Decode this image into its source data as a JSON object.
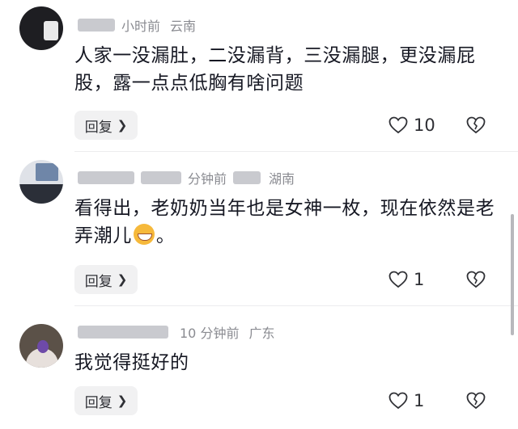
{
  "comments": [
    {
      "location": "云南",
      "time_partial": "小时前",
      "text": "人家一没漏肚，二没漏背，三没漏腿，更没漏屁股，露一点点低胸有啥问题",
      "reply_label": "回复",
      "likes": "10"
    },
    {
      "location": "湖南",
      "time_partial": "分钟前",
      "text_before_emoji": "看得出，老奶奶当年也是女神一枚，现在依然是老弄潮儿",
      "text_after_emoji": "。",
      "emoji": "grinning-emoji",
      "reply_label": "回复",
      "likes": "1"
    },
    {
      "location": "广东",
      "time_partial": "10 分钟前",
      "text": "我觉得挺好的",
      "reply_label": "回复",
      "likes": "1"
    }
  ],
  "icons": {
    "like": "heart-outline-icon",
    "dislike": "broken-heart-icon",
    "reply_chevron": "chevron-right-icon"
  },
  "colors": {
    "text": "#161823",
    "meta": "#8a8b91",
    "button_bg": "#f1f1f2"
  }
}
